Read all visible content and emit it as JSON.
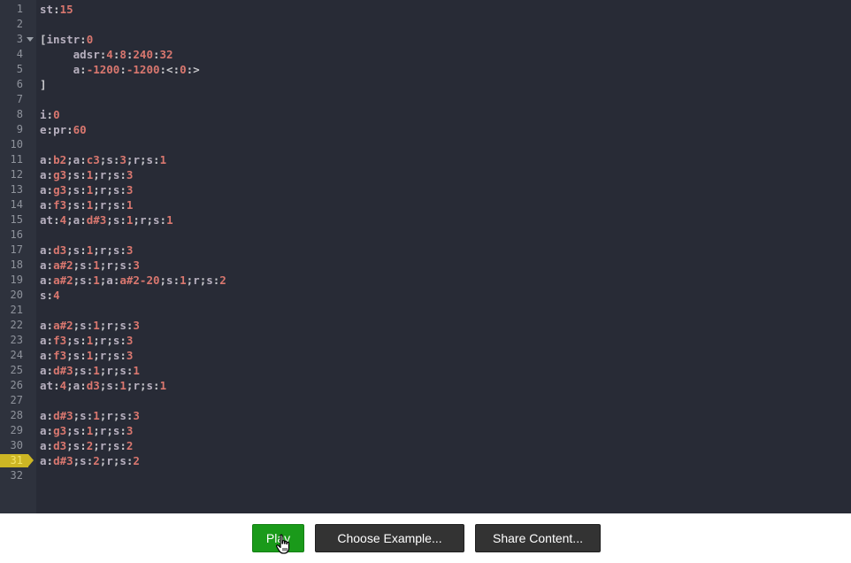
{
  "editor": {
    "current_line": 31,
    "lines": [
      {
        "n": "1",
        "tokens": [
          [
            "k",
            "st"
          ],
          [
            "p",
            ":"
          ],
          [
            "v",
            "15"
          ]
        ]
      },
      {
        "n": "2",
        "tokens": []
      },
      {
        "n": "3",
        "fold": true,
        "tokens": [
          [
            "p",
            "["
          ],
          [
            "k",
            "instr"
          ],
          [
            "p",
            ":"
          ],
          [
            "v",
            "0"
          ]
        ]
      },
      {
        "n": "4",
        "tokens": [
          [
            "p",
            "     "
          ],
          [
            "k",
            "adsr"
          ],
          [
            "p",
            ":"
          ],
          [
            "v",
            "4"
          ],
          [
            "p",
            ":"
          ],
          [
            "v",
            "8"
          ],
          [
            "p",
            ":"
          ],
          [
            "v",
            "240"
          ],
          [
            "p",
            ":"
          ],
          [
            "v",
            "32"
          ]
        ]
      },
      {
        "n": "5",
        "tokens": [
          [
            "p",
            "     "
          ],
          [
            "k",
            "a"
          ],
          [
            "p",
            ":"
          ],
          [
            "v",
            "-1200"
          ],
          [
            "p",
            ":"
          ],
          [
            "v",
            "-1200"
          ],
          [
            "p",
            ":<:"
          ],
          [
            "v",
            "0"
          ],
          [
            "p",
            ":>"
          ]
        ]
      },
      {
        "n": "6",
        "tokens": [
          [
            "p",
            "]"
          ]
        ]
      },
      {
        "n": "7",
        "tokens": []
      },
      {
        "n": "8",
        "tokens": [
          [
            "k",
            "i"
          ],
          [
            "p",
            ":"
          ],
          [
            "v",
            "0"
          ]
        ]
      },
      {
        "n": "9",
        "tokens": [
          [
            "k",
            "e"
          ],
          [
            "p",
            ":"
          ],
          [
            "k",
            "pr"
          ],
          [
            "p",
            ":"
          ],
          [
            "v",
            "60"
          ]
        ]
      },
      {
        "n": "10",
        "tokens": []
      },
      {
        "n": "11",
        "tokens": [
          [
            "k",
            "a"
          ],
          [
            "p",
            ":"
          ],
          [
            "v",
            "b2"
          ],
          [
            "p",
            ";"
          ],
          [
            "k",
            "a"
          ],
          [
            "p",
            ":"
          ],
          [
            "v",
            "c3"
          ],
          [
            "p",
            ";"
          ],
          [
            "k",
            "s"
          ],
          [
            "p",
            ":"
          ],
          [
            "v",
            "3"
          ],
          [
            "p",
            ";"
          ],
          [
            "k",
            "r"
          ],
          [
            "p",
            ";"
          ],
          [
            "k",
            "s"
          ],
          [
            "p",
            ":"
          ],
          [
            "v",
            "1"
          ]
        ]
      },
      {
        "n": "12",
        "tokens": [
          [
            "k",
            "a"
          ],
          [
            "p",
            ":"
          ],
          [
            "v",
            "g3"
          ],
          [
            "p",
            ";"
          ],
          [
            "k",
            "s"
          ],
          [
            "p",
            ":"
          ],
          [
            "v",
            "1"
          ],
          [
            "p",
            ";"
          ],
          [
            "k",
            "r"
          ],
          [
            "p",
            ";"
          ],
          [
            "k",
            "s"
          ],
          [
            "p",
            ":"
          ],
          [
            "v",
            "3"
          ]
        ]
      },
      {
        "n": "13",
        "tokens": [
          [
            "k",
            "a"
          ],
          [
            "p",
            ":"
          ],
          [
            "v",
            "g3"
          ],
          [
            "p",
            ";"
          ],
          [
            "k",
            "s"
          ],
          [
            "p",
            ":"
          ],
          [
            "v",
            "1"
          ],
          [
            "p",
            ";"
          ],
          [
            "k",
            "r"
          ],
          [
            "p",
            ";"
          ],
          [
            "k",
            "s"
          ],
          [
            "p",
            ":"
          ],
          [
            "v",
            "3"
          ]
        ]
      },
      {
        "n": "14",
        "tokens": [
          [
            "k",
            "a"
          ],
          [
            "p",
            ":"
          ],
          [
            "v",
            "f3"
          ],
          [
            "p",
            ";"
          ],
          [
            "k",
            "s"
          ],
          [
            "p",
            ":"
          ],
          [
            "v",
            "1"
          ],
          [
            "p",
            ";"
          ],
          [
            "k",
            "r"
          ],
          [
            "p",
            ";"
          ],
          [
            "k",
            "s"
          ],
          [
            "p",
            ":"
          ],
          [
            "v",
            "1"
          ]
        ]
      },
      {
        "n": "15",
        "tokens": [
          [
            "k",
            "at"
          ],
          [
            "p",
            ":"
          ],
          [
            "v",
            "4"
          ],
          [
            "p",
            ";"
          ],
          [
            "k",
            "a"
          ],
          [
            "p",
            ":"
          ],
          [
            "v",
            "d#3"
          ],
          [
            "p",
            ";"
          ],
          [
            "k",
            "s"
          ],
          [
            "p",
            ":"
          ],
          [
            "v",
            "1"
          ],
          [
            "p",
            ";"
          ],
          [
            "k",
            "r"
          ],
          [
            "p",
            ";"
          ],
          [
            "k",
            "s"
          ],
          [
            "p",
            ":"
          ],
          [
            "v",
            "1"
          ]
        ]
      },
      {
        "n": "16",
        "tokens": []
      },
      {
        "n": "17",
        "tokens": [
          [
            "k",
            "a"
          ],
          [
            "p",
            ":"
          ],
          [
            "v",
            "d3"
          ],
          [
            "p",
            ";"
          ],
          [
            "k",
            "s"
          ],
          [
            "p",
            ":"
          ],
          [
            "v",
            "1"
          ],
          [
            "p",
            ";"
          ],
          [
            "k",
            "r"
          ],
          [
            "p",
            ";"
          ],
          [
            "k",
            "s"
          ],
          [
            "p",
            ":"
          ],
          [
            "v",
            "3"
          ]
        ]
      },
      {
        "n": "18",
        "tokens": [
          [
            "k",
            "a"
          ],
          [
            "p",
            ":"
          ],
          [
            "v",
            "a#2"
          ],
          [
            "p",
            ";"
          ],
          [
            "k",
            "s"
          ],
          [
            "p",
            ":"
          ],
          [
            "v",
            "1"
          ],
          [
            "p",
            ";"
          ],
          [
            "k",
            "r"
          ],
          [
            "p",
            ";"
          ],
          [
            "k",
            "s"
          ],
          [
            "p",
            ":"
          ],
          [
            "v",
            "3"
          ]
        ]
      },
      {
        "n": "19",
        "tokens": [
          [
            "k",
            "a"
          ],
          [
            "p",
            ":"
          ],
          [
            "v",
            "a#2"
          ],
          [
            "p",
            ";"
          ],
          [
            "k",
            "s"
          ],
          [
            "p",
            ":"
          ],
          [
            "v",
            "1"
          ],
          [
            "p",
            ";"
          ],
          [
            "k",
            "a"
          ],
          [
            "p",
            ":"
          ],
          [
            "v",
            "a#2-20"
          ],
          [
            "p",
            ";"
          ],
          [
            "k",
            "s"
          ],
          [
            "p",
            ":"
          ],
          [
            "v",
            "1"
          ],
          [
            "p",
            ";"
          ],
          [
            "k",
            "r"
          ],
          [
            "p",
            ";"
          ],
          [
            "k",
            "s"
          ],
          [
            "p",
            ":"
          ],
          [
            "v",
            "2"
          ]
        ]
      },
      {
        "n": "20",
        "tokens": [
          [
            "k",
            "s"
          ],
          [
            "p",
            ":"
          ],
          [
            "v",
            "4"
          ]
        ]
      },
      {
        "n": "21",
        "tokens": []
      },
      {
        "n": "22",
        "tokens": [
          [
            "k",
            "a"
          ],
          [
            "p",
            ":"
          ],
          [
            "v",
            "a#2"
          ],
          [
            "p",
            ";"
          ],
          [
            "k",
            "s"
          ],
          [
            "p",
            ":"
          ],
          [
            "v",
            "1"
          ],
          [
            "p",
            ";"
          ],
          [
            "k",
            "r"
          ],
          [
            "p",
            ";"
          ],
          [
            "k",
            "s"
          ],
          [
            "p",
            ":"
          ],
          [
            "v",
            "3"
          ]
        ]
      },
      {
        "n": "23",
        "tokens": [
          [
            "k",
            "a"
          ],
          [
            "p",
            ":"
          ],
          [
            "v",
            "f3"
          ],
          [
            "p",
            ";"
          ],
          [
            "k",
            "s"
          ],
          [
            "p",
            ":"
          ],
          [
            "v",
            "1"
          ],
          [
            "p",
            ";"
          ],
          [
            "k",
            "r"
          ],
          [
            "p",
            ";"
          ],
          [
            "k",
            "s"
          ],
          [
            "p",
            ":"
          ],
          [
            "v",
            "3"
          ]
        ]
      },
      {
        "n": "24",
        "tokens": [
          [
            "k",
            "a"
          ],
          [
            "p",
            ":"
          ],
          [
            "v",
            "f3"
          ],
          [
            "p",
            ";"
          ],
          [
            "k",
            "s"
          ],
          [
            "p",
            ":"
          ],
          [
            "v",
            "1"
          ],
          [
            "p",
            ";"
          ],
          [
            "k",
            "r"
          ],
          [
            "p",
            ";"
          ],
          [
            "k",
            "s"
          ],
          [
            "p",
            ":"
          ],
          [
            "v",
            "3"
          ]
        ]
      },
      {
        "n": "25",
        "tokens": [
          [
            "k",
            "a"
          ],
          [
            "p",
            ":"
          ],
          [
            "v",
            "d#3"
          ],
          [
            "p",
            ";"
          ],
          [
            "k",
            "s"
          ],
          [
            "p",
            ":"
          ],
          [
            "v",
            "1"
          ],
          [
            "p",
            ";"
          ],
          [
            "k",
            "r"
          ],
          [
            "p",
            ";"
          ],
          [
            "k",
            "s"
          ],
          [
            "p",
            ":"
          ],
          [
            "v",
            "1"
          ]
        ]
      },
      {
        "n": "26",
        "tokens": [
          [
            "k",
            "at"
          ],
          [
            "p",
            ":"
          ],
          [
            "v",
            "4"
          ],
          [
            "p",
            ";"
          ],
          [
            "k",
            "a"
          ],
          [
            "p",
            ":"
          ],
          [
            "v",
            "d3"
          ],
          [
            "p",
            ";"
          ],
          [
            "k",
            "s"
          ],
          [
            "p",
            ":"
          ],
          [
            "v",
            "1"
          ],
          [
            "p",
            ";"
          ],
          [
            "k",
            "r"
          ],
          [
            "p",
            ";"
          ],
          [
            "k",
            "s"
          ],
          [
            "p",
            ":"
          ],
          [
            "v",
            "1"
          ]
        ]
      },
      {
        "n": "27",
        "tokens": []
      },
      {
        "n": "28",
        "tokens": [
          [
            "k",
            "a"
          ],
          [
            "p",
            ":"
          ],
          [
            "v",
            "d#3"
          ],
          [
            "p",
            ";"
          ],
          [
            "k",
            "s"
          ],
          [
            "p",
            ":"
          ],
          [
            "v",
            "1"
          ],
          [
            "p",
            ";"
          ],
          [
            "k",
            "r"
          ],
          [
            "p",
            ";"
          ],
          [
            "k",
            "s"
          ],
          [
            "p",
            ":"
          ],
          [
            "v",
            "3"
          ]
        ]
      },
      {
        "n": "29",
        "tokens": [
          [
            "k",
            "a"
          ],
          [
            "p",
            ":"
          ],
          [
            "v",
            "g3"
          ],
          [
            "p",
            ";"
          ],
          [
            "k",
            "s"
          ],
          [
            "p",
            ":"
          ],
          [
            "v",
            "1"
          ],
          [
            "p",
            ";"
          ],
          [
            "k",
            "r"
          ],
          [
            "p",
            ";"
          ],
          [
            "k",
            "s"
          ],
          [
            "p",
            ":"
          ],
          [
            "v",
            "3"
          ]
        ]
      },
      {
        "n": "30",
        "tokens": [
          [
            "k",
            "a"
          ],
          [
            "p",
            ":"
          ],
          [
            "v",
            "d3"
          ],
          [
            "p",
            ";"
          ],
          [
            "k",
            "s"
          ],
          [
            "p",
            ":"
          ],
          [
            "v",
            "2"
          ],
          [
            "p",
            ";"
          ],
          [
            "k",
            "r"
          ],
          [
            "p",
            ";"
          ],
          [
            "k",
            "s"
          ],
          [
            "p",
            ":"
          ],
          [
            "v",
            "2"
          ]
        ]
      },
      {
        "n": "31",
        "tokens": [
          [
            "k",
            "a"
          ],
          [
            "p",
            ":"
          ],
          [
            "v",
            "d#3"
          ],
          [
            "p",
            ";"
          ],
          [
            "k",
            "s"
          ],
          [
            "p",
            ":"
          ],
          [
            "v",
            "2"
          ],
          [
            "p",
            ";"
          ],
          [
            "k",
            "r"
          ],
          [
            "p",
            ";"
          ],
          [
            "k",
            "s"
          ],
          [
            "p",
            ":"
          ],
          [
            "v",
            "2"
          ]
        ]
      },
      {
        "n": "32",
        "tokens": []
      }
    ]
  },
  "toolbar": {
    "play_label": "Play",
    "choose_label": "Choose Example...",
    "share_label": "Share Content..."
  },
  "colors": {
    "editor_bg": "#282b36",
    "keyword": "#b7b0bf",
    "value": "#d9776f",
    "play_green": "#1a9a1a",
    "current_line_marker": "#cdb624"
  },
  "icons": {
    "fold": "fold-arrow-icon",
    "cursor": "hand-pointer-icon"
  }
}
